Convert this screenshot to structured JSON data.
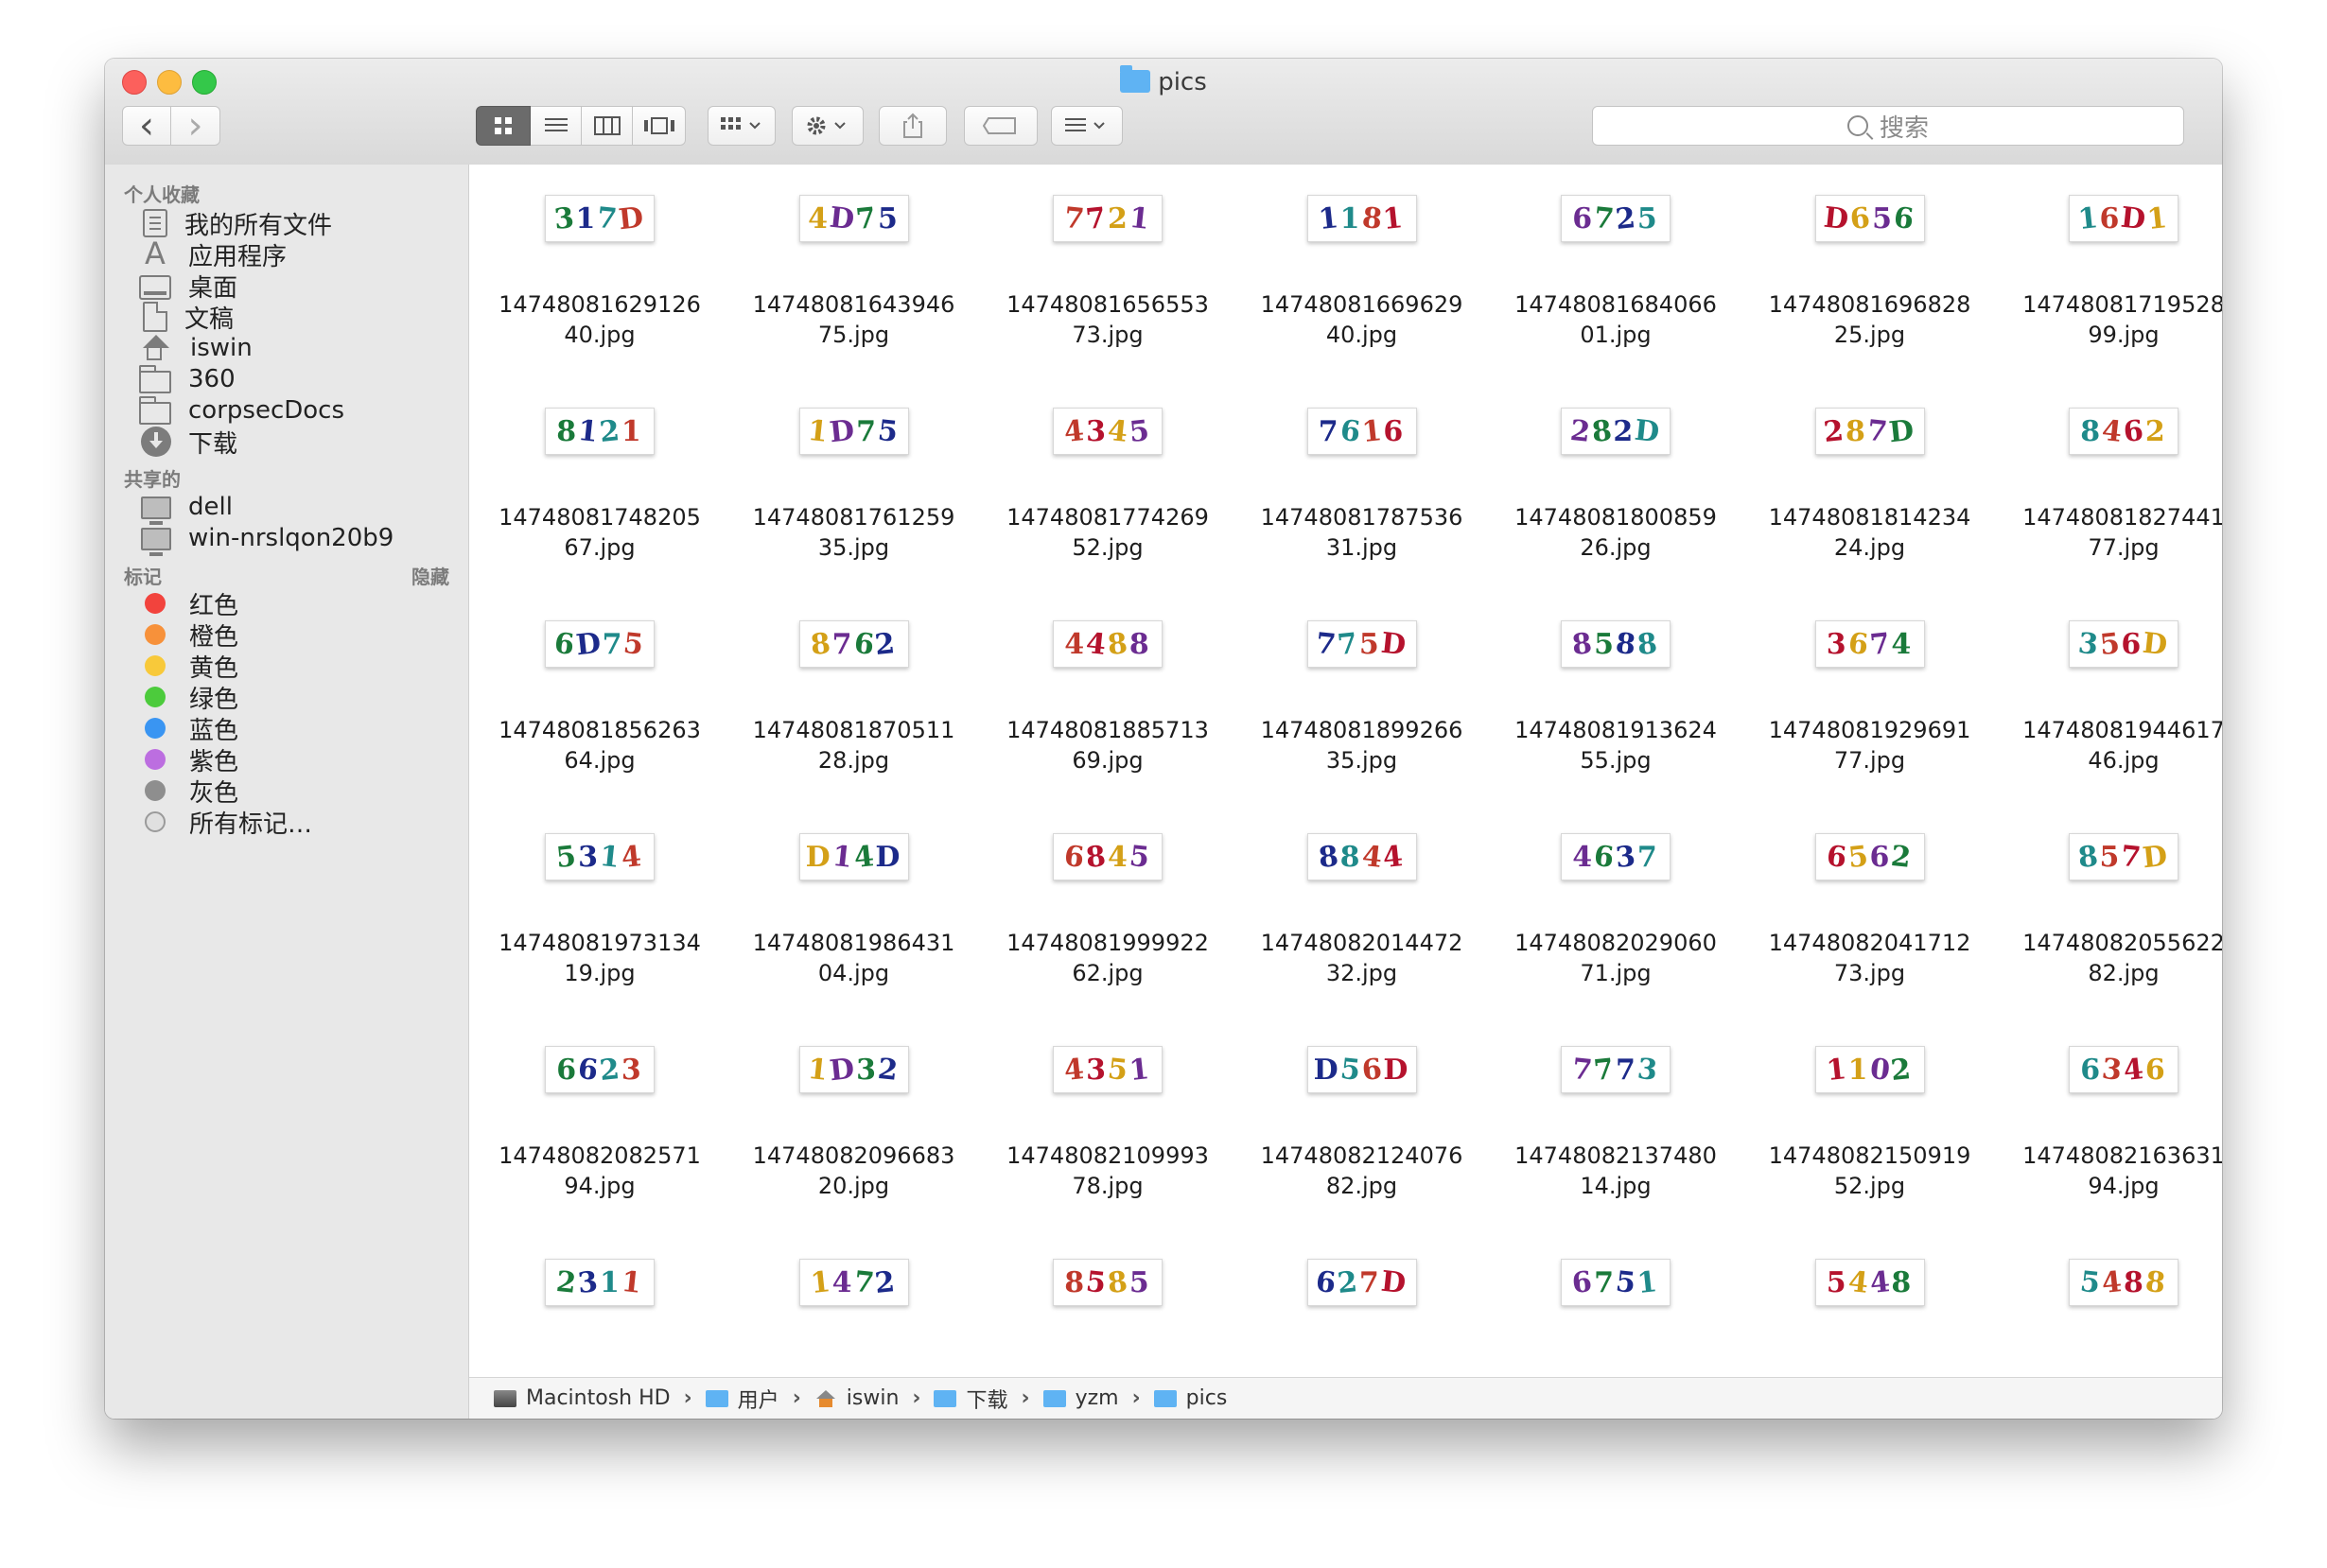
{
  "window": {
    "title": "pics"
  },
  "toolbar": {
    "back": "‹",
    "forward": "›",
    "search_placeholder": "搜索"
  },
  "sidebar": {
    "favorites_header": "个人收藏",
    "favorites": [
      {
        "label": "我的所有文件",
        "icon": "all-files-icon"
      },
      {
        "label": "应用程序",
        "icon": "applications-icon"
      },
      {
        "label": "桌面",
        "icon": "desktop-icon"
      },
      {
        "label": "文稿",
        "icon": "documents-icon"
      },
      {
        "label": "iswin",
        "icon": "home-icon"
      },
      {
        "label": "360",
        "icon": "folder-icon"
      },
      {
        "label": "corpsecDocs",
        "icon": "folder-icon"
      },
      {
        "label": "下载",
        "icon": "downloads-icon"
      }
    ],
    "shared_header": "共享的",
    "shared": [
      {
        "label": "dell",
        "icon": "computer-icon"
      },
      {
        "label": "win-nrslqon20b9",
        "icon": "computer-icon"
      }
    ],
    "tags_header": "标记",
    "tags_hide": "隐藏",
    "tags": [
      {
        "label": "红色",
        "color": "#f2433d"
      },
      {
        "label": "橙色",
        "color": "#f7913a"
      },
      {
        "label": "黄色",
        "color": "#f8c93a"
      },
      {
        "label": "绿色",
        "color": "#4ccb3c"
      },
      {
        "label": "蓝色",
        "color": "#3a95f2"
      },
      {
        "label": "紫色",
        "color": "#bc6ee0"
      },
      {
        "label": "灰色",
        "color": "#8e8e8e"
      },
      {
        "label": "所有标记…",
        "color": ""
      }
    ]
  },
  "files": [
    {
      "code": "317D",
      "line1": "14748081629126",
      "line2": "40.jpg"
    },
    {
      "code": "4D75",
      "line1": "14748081643946",
      "line2": "75.jpg"
    },
    {
      "code": "7721",
      "line1": "14748081656553",
      "line2": "73.jpg"
    },
    {
      "code": "1181",
      "line1": "14748081669629",
      "line2": "40.jpg"
    },
    {
      "code": "6725",
      "line1": "14748081684066",
      "line2": "01.jpg"
    },
    {
      "code": "D656",
      "line1": "14748081696828",
      "line2": "25.jpg"
    },
    {
      "code": "16D1",
      "line1": "14748081719528",
      "line2": "99.jpg"
    },
    {
      "code": "8121",
      "line1": "14748081748205",
      "line2": "67.jpg"
    },
    {
      "code": "1D75",
      "line1": "14748081761259",
      "line2": "35.jpg"
    },
    {
      "code": "4345",
      "line1": "14748081774269",
      "line2": "52.jpg"
    },
    {
      "code": "7616",
      "line1": "14748081787536",
      "line2": "31.jpg"
    },
    {
      "code": "282D",
      "line1": "14748081800859",
      "line2": "26.jpg"
    },
    {
      "code": "287D",
      "line1": "14748081814234",
      "line2": "24.jpg"
    },
    {
      "code": "8462",
      "line1": "14748081827441",
      "line2": "77.jpg"
    },
    {
      "code": "6D75",
      "line1": "14748081856263",
      "line2": "64.jpg"
    },
    {
      "code": "8762",
      "line1": "14748081870511",
      "line2": "28.jpg"
    },
    {
      "code": "4488",
      "line1": "14748081885713",
      "line2": "69.jpg"
    },
    {
      "code": "775D",
      "line1": "14748081899266",
      "line2": "35.jpg"
    },
    {
      "code": "8588",
      "line1": "14748081913624",
      "line2": "55.jpg"
    },
    {
      "code": "3674",
      "line1": "14748081929691",
      "line2": "77.jpg"
    },
    {
      "code": "356D",
      "line1": "14748081944617",
      "line2": "46.jpg"
    },
    {
      "code": "5314",
      "line1": "14748081973134",
      "line2": "19.jpg"
    },
    {
      "code": "D14D",
      "line1": "14748081986431",
      "line2": "04.jpg"
    },
    {
      "code": "6845",
      "line1": "14748081999922",
      "line2": "62.jpg"
    },
    {
      "code": "8844",
      "line1": "14748082014472",
      "line2": "32.jpg"
    },
    {
      "code": "4637",
      "line1": "14748082029060",
      "line2": "71.jpg"
    },
    {
      "code": "6562",
      "line1": "14748082041712",
      "line2": "73.jpg"
    },
    {
      "code": "857D",
      "line1": "14748082055622",
      "line2": "82.jpg"
    },
    {
      "code": "6623",
      "line1": "14748082082571",
      "line2": "94.jpg"
    },
    {
      "code": "1D32",
      "line1": "14748082096683",
      "line2": "20.jpg"
    },
    {
      "code": "4351",
      "line1": "14748082109993",
      "line2": "78.jpg"
    },
    {
      "code": "D56D",
      "line1": "14748082124076",
      "line2": "82.jpg"
    },
    {
      "code": "7773",
      "line1": "14748082137480",
      "line2": "14.jpg"
    },
    {
      "code": "1102",
      "line1": "14748082150919",
      "line2": "52.jpg"
    },
    {
      "code": "6346",
      "line1": "14748082163631",
      "line2": "94.jpg"
    },
    {
      "code": "2311",
      "line1": "",
      "line2": ""
    },
    {
      "code": "1472",
      "line1": "",
      "line2": ""
    },
    {
      "code": "8585",
      "line1": "",
      "line2": ""
    },
    {
      "code": "627D",
      "line1": "",
      "line2": ""
    },
    {
      "code": "6751",
      "line1": "",
      "line2": ""
    },
    {
      "code": "5448",
      "line1": "",
      "line2": ""
    },
    {
      "code": "5488",
      "line1": "",
      "line2": ""
    }
  ],
  "captcha_colors": [
    "#1a7a3a",
    "#b5122d",
    "#1c2a8a",
    "#d4a017",
    "#1f8a8a",
    "#6b2c91",
    "#c0392b"
  ],
  "pathbar": [
    {
      "label": "Macintosh HD",
      "icon": "hard-drive-icon"
    },
    {
      "label": "用户",
      "icon": "folder-icon"
    },
    {
      "label": "iswin",
      "icon": "home-icon"
    },
    {
      "label": "下载",
      "icon": "folder-icon"
    },
    {
      "label": "yzm",
      "icon": "folder-icon"
    },
    {
      "label": "pics",
      "icon": "folder-icon"
    }
  ],
  "pathbar_separator": "›"
}
